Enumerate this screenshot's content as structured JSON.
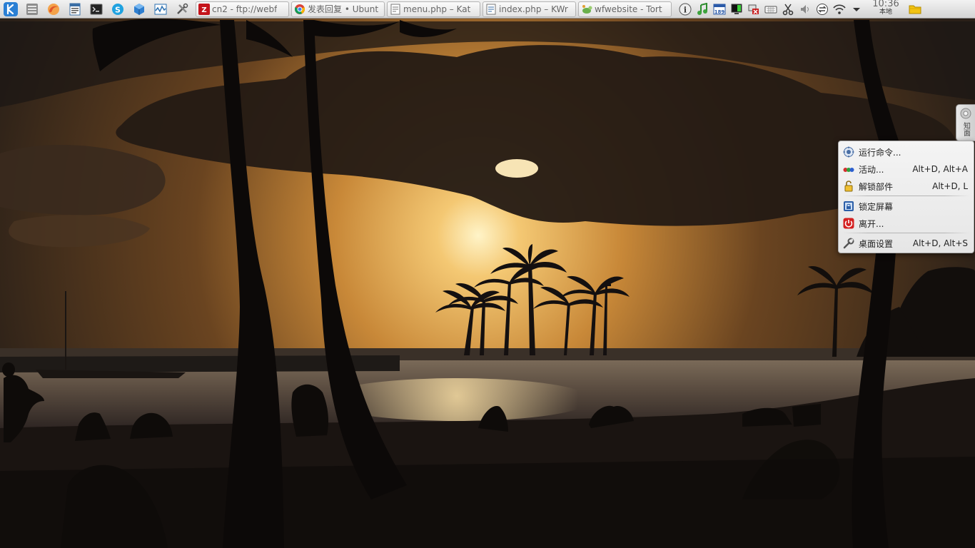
{
  "panel": {
    "launchers": [
      {
        "name": "kde-menu-icon"
      },
      {
        "name": "dolphin-file-manager-icon"
      },
      {
        "name": "firefox-icon"
      },
      {
        "name": "writer-document-icon"
      },
      {
        "name": "terminal-icon"
      },
      {
        "name": "skype-icon"
      },
      {
        "name": "virtualbox-icon"
      },
      {
        "name": "system-monitor-icon"
      },
      {
        "name": "settings-tools-icon"
      }
    ],
    "tasks": [
      {
        "icon": "filezilla-icon",
        "label": "cn2 - ftp://webf"
      },
      {
        "icon": "chrome-icon",
        "label": "发表回复 • Ubunt"
      },
      {
        "icon": "kate-document-icon",
        "label": "menu.php – Kat"
      },
      {
        "icon": "kwrite-document-icon",
        "label": "index.php – KWr"
      },
      {
        "icon": "tortoise-icon",
        "label": "wfwebsite - Tort"
      }
    ],
    "clock": {
      "time": "10:36",
      "zone": "本地"
    },
    "tray_badge": "189"
  },
  "toolbox": {
    "label": "知面"
  },
  "context_menu": {
    "items": [
      {
        "label": "运行命令...",
        "shortcut": "",
        "icon": "run-command-icon"
      },
      {
        "label": "活动...",
        "shortcut": "Alt+D, Alt+A",
        "icon": "activities-icon"
      },
      {
        "label": "解锁部件",
        "shortcut": "Alt+D, L",
        "icon": "unlock-icon"
      },
      {
        "label": "锁定屏幕",
        "shortcut": "",
        "icon": "lock-screen-icon"
      },
      {
        "label": "离开...",
        "shortcut": "",
        "icon": "power-icon"
      },
      {
        "label": "桌面设置",
        "shortcut": "Alt+D, Alt+S",
        "icon": "wrench-icon"
      }
    ]
  },
  "colors": {
    "panel_bg": "#e0e0e0",
    "menu_bg": "#ececec",
    "sky_glow": "#ffe9a8",
    "sky_orange": "#c98a3a",
    "kde_blue": "#2a7fd4"
  }
}
